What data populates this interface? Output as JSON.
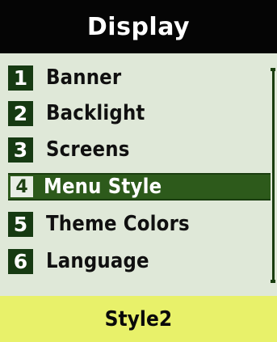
{
  "header": {
    "title": "Display"
  },
  "menu": {
    "items": [
      {
        "number": "1",
        "label": "Banner",
        "selected": false
      },
      {
        "number": "2",
        "label": "Backlight",
        "selected": false
      },
      {
        "number": "3",
        "label": "Screens",
        "selected": false
      },
      {
        "number": "4",
        "label": "Menu Style",
        "selected": true
      },
      {
        "number": "5",
        "label": "Theme Colors",
        "selected": false
      },
      {
        "number": "6",
        "label": "Language",
        "selected": false
      }
    ]
  },
  "footer": {
    "softkey_label": "Style2"
  },
  "colors": {
    "background": "#dfe8d8",
    "title_bar": "#050505",
    "highlight": "#2d5a1b",
    "footer": "#e8f16a"
  }
}
